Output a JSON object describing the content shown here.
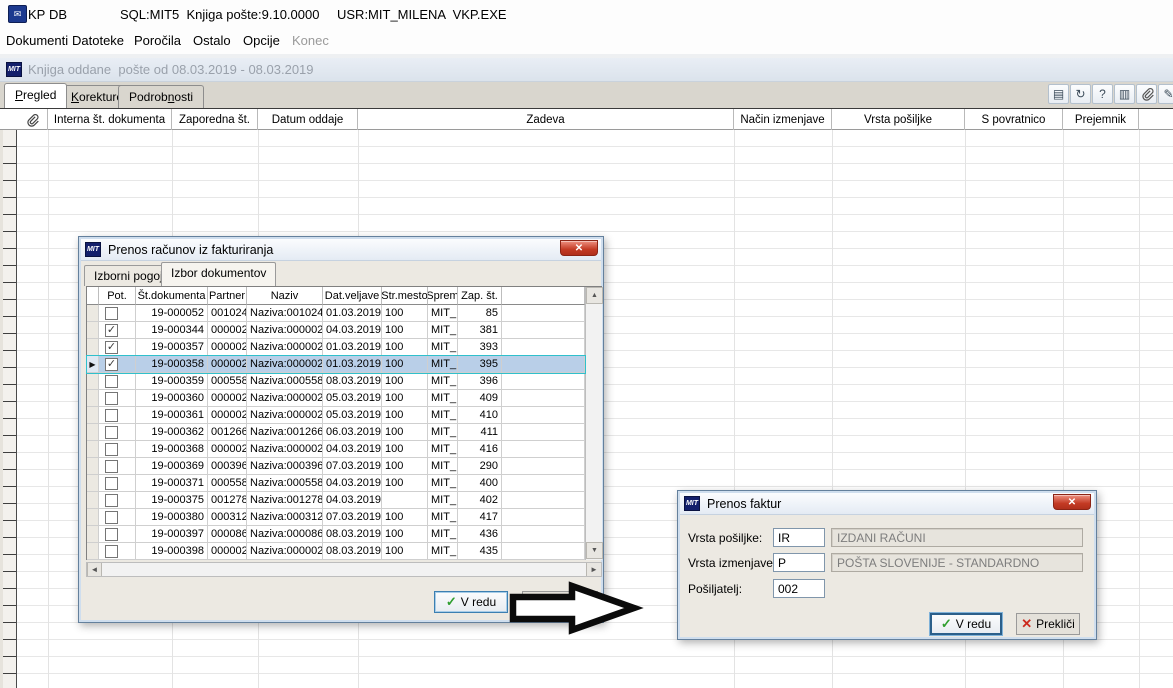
{
  "colors": {
    "accent_blue": "#3c7fb1",
    "selected_row": "#b9cfe8",
    "selection_outline": "#2fc0cc",
    "close_button_red": "#c33a24",
    "check_green": "#2f9e2f",
    "cross_red": "#cc281c",
    "inactive_title_text": "#9aa1ab"
  },
  "topbar": {
    "app_code": "KP",
    "db_label": "DB",
    "sql_info": "SQL:MIT5  Knjiga pošte:9.10.0000",
    "user_info": "USR:MIT_MILENA  VKP.EXE"
  },
  "menubar": {
    "items": [
      {
        "label": "Dokumenti",
        "enabled": true
      },
      {
        "label": "Datoteke",
        "enabled": true
      },
      {
        "label": "Poročila",
        "enabled": true
      },
      {
        "label": "Ostalo",
        "enabled": true
      },
      {
        "label": "Opcije",
        "enabled": true
      },
      {
        "label": "Konec",
        "enabled": false
      }
    ]
  },
  "window": {
    "title": "Knjiga oddane  pošte od 08.03.2019 - 08.03.2019",
    "tabs": [
      {
        "label": "Pregled",
        "active": true,
        "underline": 0
      },
      {
        "label": "Korekture",
        "active": false,
        "underline": 0
      },
      {
        "label": "Podrobnosti",
        "active": false,
        "underline": 6
      }
    ],
    "toolbar_icons": [
      {
        "name": "report-icon",
        "glyph": "▤"
      },
      {
        "name": "refresh-send-icon",
        "glyph": "↻"
      },
      {
        "name": "help-window-icon",
        "glyph": "?"
      },
      {
        "name": "attachments-cards-icon",
        "glyph": "▥"
      },
      {
        "name": "paperclip-icon",
        "glyph": "paperclip"
      },
      {
        "name": "edit-pencil-icon",
        "glyph": "✎"
      }
    ],
    "grid_columns": [
      "",
      "Interna št. dokumenta",
      "Zaporedna št.",
      "Datum oddaje",
      "Zadeva",
      "Način izmenjave",
      "Vrsta pošiljke",
      "S povratnico",
      "Prejemnik"
    ]
  },
  "transfer_dialog": {
    "title": "Prenos računov iz fakturiranja",
    "tabs": [
      {
        "label": "Izborni pogoji",
        "active": false
      },
      {
        "label": "Izbor dokumentov",
        "active": true
      }
    ],
    "columns": [
      "Pot.",
      "Št.dokumenta",
      "Partner",
      "Naziv",
      "Dat.veljave",
      "Str.mesto",
      "Sprem",
      "Zap. št."
    ],
    "rows": [
      {
        "checked": false,
        "selected": false,
        "doc": "19-000052",
        "partner": "001024",
        "naziv": "Naziva:001024",
        "datum": "01.03.2019",
        "str_mesto": "100",
        "sprem": "MIT_",
        "zap": "85"
      },
      {
        "checked": true,
        "selected": false,
        "doc": "19-000344",
        "partner": "000002",
        "naziv": "Naziva:000002",
        "datum": "04.03.2019",
        "str_mesto": "100",
        "sprem": "MIT_",
        "zap": "381"
      },
      {
        "checked": true,
        "selected": false,
        "doc": "19-000357",
        "partner": "000002",
        "naziv": "Naziva:000002",
        "datum": "01.03.2019",
        "str_mesto": "100",
        "sprem": "MIT_",
        "zap": "393"
      },
      {
        "checked": true,
        "selected": true,
        "doc": "19-000358",
        "partner": "000002",
        "naziv": "Naziva:000002",
        "datum": "01.03.2019",
        "str_mesto": "100",
        "sprem": "MIT_",
        "zap": "395"
      },
      {
        "checked": false,
        "selected": false,
        "doc": "19-000359",
        "partner": "000558",
        "naziv": "Naziva:000558",
        "datum": "08.03.2019",
        "str_mesto": "100",
        "sprem": "MIT_",
        "zap": "396"
      },
      {
        "checked": false,
        "selected": false,
        "doc": "19-000360",
        "partner": "000002",
        "naziv": "Naziva:000002",
        "datum": "05.03.2019",
        "str_mesto": "100",
        "sprem": "MIT_",
        "zap": "409"
      },
      {
        "checked": false,
        "selected": false,
        "doc": "19-000361",
        "partner": "000002",
        "naziv": "Naziva:000002",
        "datum": "05.03.2019",
        "str_mesto": "100",
        "sprem": "MIT_",
        "zap": "410"
      },
      {
        "checked": false,
        "selected": false,
        "doc": "19-000362",
        "partner": "001266",
        "naziv": "Naziva:001266",
        "datum": "06.03.2019",
        "str_mesto": "100",
        "sprem": "MIT_",
        "zap": "411"
      },
      {
        "checked": false,
        "selected": false,
        "doc": "19-000368",
        "partner": "000002",
        "naziv": "Naziva:000002",
        "datum": "04.03.2019",
        "str_mesto": "100",
        "sprem": "MIT_",
        "zap": "416"
      },
      {
        "checked": false,
        "selected": false,
        "doc": "19-000369",
        "partner": "000396",
        "naziv": "Naziva:000396",
        "datum": "07.03.2019",
        "str_mesto": "100",
        "sprem": "MIT_",
        "zap": "290"
      },
      {
        "checked": false,
        "selected": false,
        "doc": "19-000371",
        "partner": "000558",
        "naziv": "Naziva:000558",
        "datum": "04.03.2019",
        "str_mesto": "100",
        "sprem": "MIT_",
        "zap": "400"
      },
      {
        "checked": false,
        "selected": false,
        "doc": "19-000375",
        "partner": "001278",
        "naziv": "Naziva:001278",
        "datum": "04.03.2019",
        "str_mesto": "",
        "sprem": "MIT_",
        "zap": "402"
      },
      {
        "checked": false,
        "selected": false,
        "doc": "19-000380",
        "partner": "000312",
        "naziv": "Naziva:000312",
        "datum": "07.03.2019",
        "str_mesto": "100",
        "sprem": "MIT_",
        "zap": "417"
      },
      {
        "checked": false,
        "selected": false,
        "doc": "19-000397",
        "partner": "000086",
        "naziv": "Naziva:000086",
        "datum": "08.03.2019",
        "str_mesto": "100",
        "sprem": "MIT_",
        "zap": "436"
      },
      {
        "checked": false,
        "selected": false,
        "doc": "19-000398",
        "partner": "000002",
        "naziv": "Naziva:000002",
        "datum": "08.03.2019",
        "str_mesto": "100",
        "sprem": "MIT_",
        "zap": "435"
      }
    ],
    "ok_label": "V redu"
  },
  "invoice_dialog": {
    "title": "Prenos faktur",
    "fields": [
      {
        "label": "Vrsta pošiljke:",
        "code": "IR",
        "value": "IZDANI RAČUNI"
      },
      {
        "label": "Vrsta izmenjave:",
        "code": "P",
        "value": "POŠTA SLOVENIJE - STANDARDNO"
      },
      {
        "label": "Pošiljatelj:",
        "code": "002",
        "value": null
      }
    ],
    "ok_label": "V redu",
    "cancel_label": "Prekliči"
  }
}
